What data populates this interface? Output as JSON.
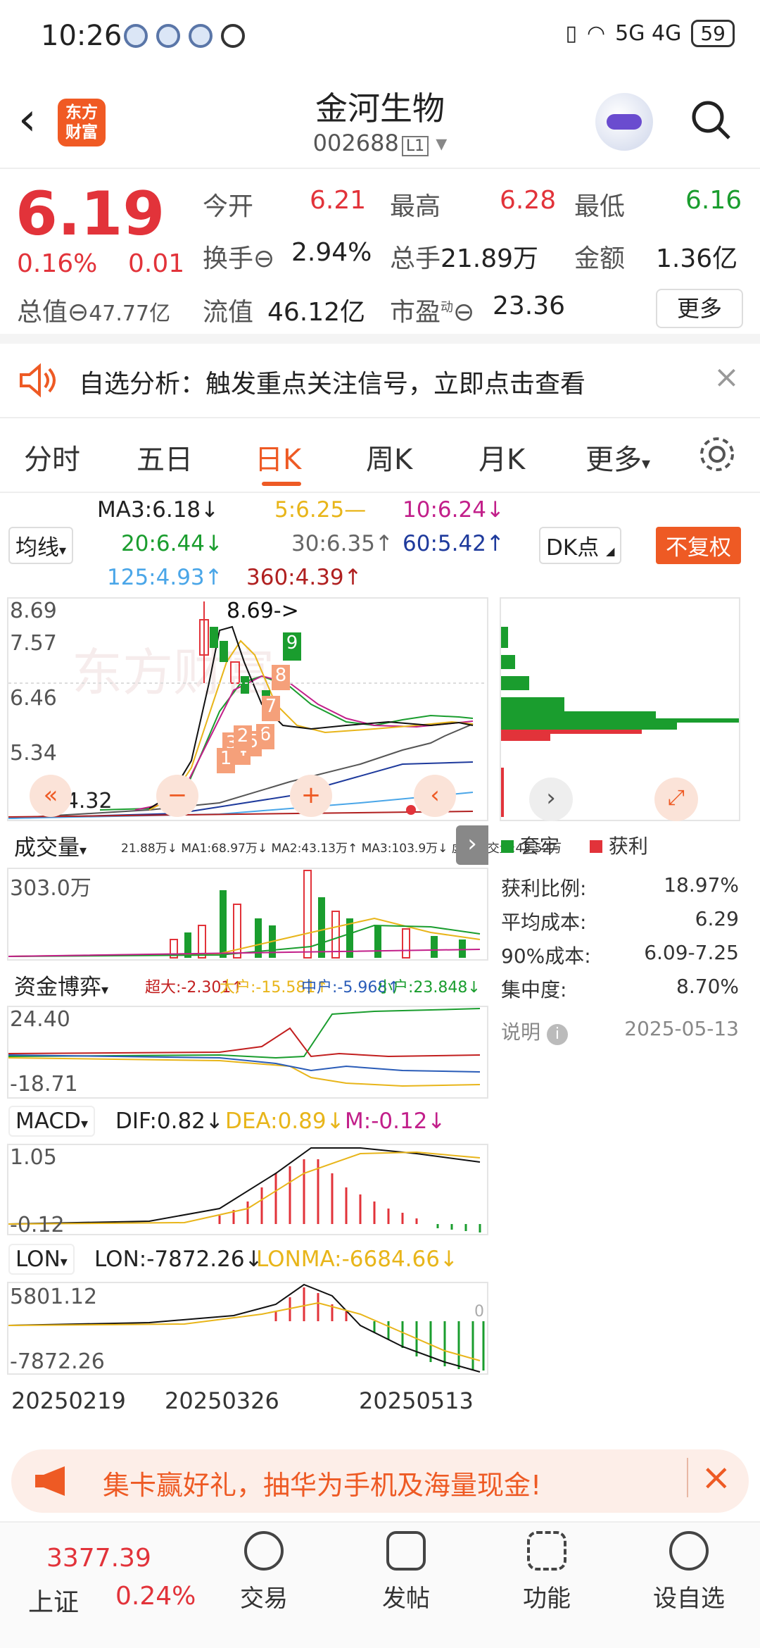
{
  "status_bar": {
    "time": "10:26",
    "network": "5G 4G",
    "battery": "59"
  },
  "header": {
    "title": "金河生物",
    "code": "002688",
    "level": "L1",
    "logo_line1": "东方",
    "logo_line2": "财富"
  },
  "quote": {
    "price": "6.19",
    "change_pct": "0.16%",
    "change": "0.01",
    "open_label": "今开",
    "open": "6.21",
    "high_label": "最高",
    "high": "6.28",
    "low_label": "最低",
    "low": "6.16",
    "turnover_label": "换手",
    "turnover": "2.94%",
    "volume_label": "总手",
    "volume": "21.89万",
    "amount_label": "金额",
    "amount": "1.36亿",
    "mktcap_label": "总值",
    "mktcap": "47.77亿",
    "float_label": "流值",
    "float": "46.12亿",
    "pe_label": "市盈",
    "pe_sup": "动",
    "pe": "23.36",
    "more_label": "更多"
  },
  "notice": {
    "text": "自选分析：触发重点关注信号，立即点击查看"
  },
  "tabs": [
    "分时",
    "五日",
    "日K",
    "周K",
    "月K",
    "更多"
  ],
  "active_tab": "日K",
  "ma": {
    "selector": "均线",
    "ma3": "MA3:6.18↓",
    "ma5": "5:6.25—",
    "ma10": "10:6.24↓",
    "ma20": "20:6.44↓",
    "ma30": "30:6.35↑",
    "ma60": "60:5.42↑",
    "ma125": "125:4.93↑",
    "ma360": "360:4.39↑",
    "dk_label": "DK点",
    "fq_label": "不复权"
  },
  "kline": {
    "y_top": "8.69",
    "y2": "7.57",
    "y3": "6.46",
    "y4": "5.34",
    "y_low": "4.32",
    "peak_label": "8.69->",
    "low_label": "<--4.32",
    "signals": [
      "1",
      "2",
      "3",
      "4",
      "5",
      "6",
      "7",
      "8",
      "9"
    ]
  },
  "volume": {
    "selector": "成交量",
    "vals": "21.88万↓ MA1:68.97万↓ MA2:43.13万↑ MA3:103.9万↓ 虚拟成交量:43.52万",
    "y_top": "303.0万"
  },
  "capital": {
    "selector": "资金博弈",
    "super": "超大:-2.301↑",
    "big": "大户:-15.581↑",
    "mid": "中户:-5.968↑",
    "small": "小户:23.848↓",
    "y_top": "24.40",
    "y_low": "-18.71"
  },
  "macd": {
    "selector": "MACD",
    "dif": "DIF:0.82↓",
    "dea": "DEA:0.89↓",
    "m": "M:-0.12↓",
    "y_top": "1.05",
    "y_low": "-0.12"
  },
  "lon": {
    "selector": "LON",
    "lon": "LON:-7872.26↓",
    "lonma": "LONMA:-6684.66↓",
    "y_top": "5801.12",
    "y_low": "-7872.26",
    "zero": "0"
  },
  "x_axis": [
    "20250219",
    "20250326",
    "20250513"
  ],
  "chip": {
    "legend_trapped": "套牢",
    "legend_profit": "获利",
    "rows": [
      {
        "k": "获利比例:",
        "v": "18.97%"
      },
      {
        "k": "平均成本:",
        "v": "6.29"
      },
      {
        "k": "90%成本:",
        "v": "6.09-7.25"
      },
      {
        "k": "集中度:",
        "v": "8.70%"
      }
    ],
    "note": "说明",
    "date": "2025-05-13"
  },
  "banner": {
    "text": "集卡赢好礼，抽华为手机及海量现金!"
  },
  "bottom": {
    "index_value": "3377.39",
    "index_name": "上证",
    "index_pct": "0.24%",
    "items": [
      "交易",
      "发帖",
      "功能",
      "设自选"
    ]
  },
  "colors": {
    "accent": "#ee5a24",
    "up": "#e2333a",
    "down": "#1a9d2e"
  }
}
